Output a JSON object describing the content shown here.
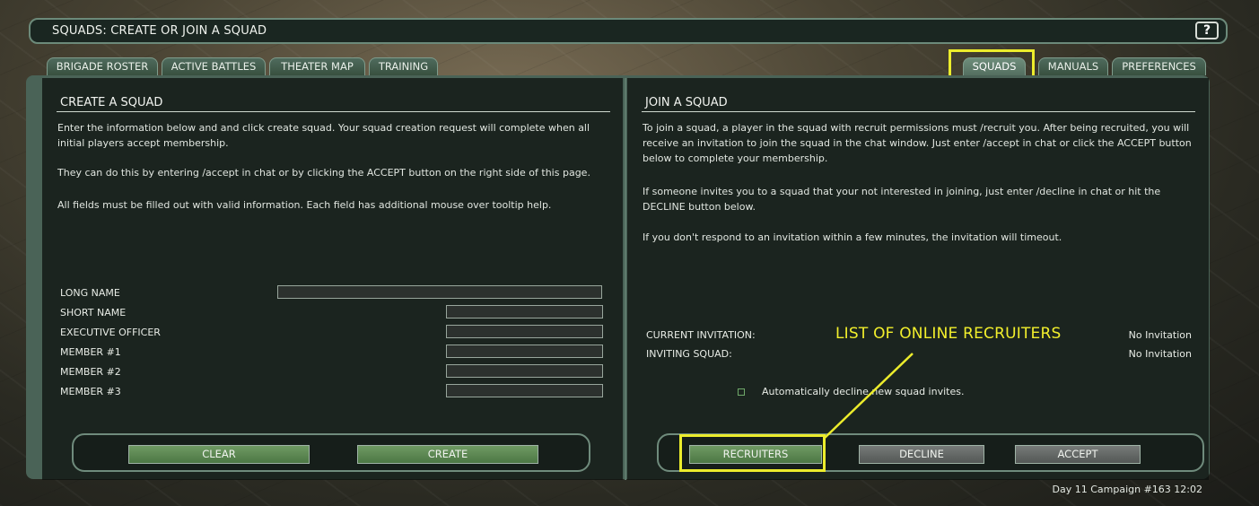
{
  "window": {
    "title": "SQUADS: CREATE OR JOIN A SQUAD",
    "help_label": "?"
  },
  "tabs_left": [
    {
      "label": "BRIGADE ROSTER"
    },
    {
      "label": "ACTIVE BATTLES"
    },
    {
      "label": "THEATER MAP"
    },
    {
      "label": "TRAINING"
    }
  ],
  "tabs_right": [
    {
      "label": "SQUADS",
      "active": true
    },
    {
      "label": "MANUALS"
    },
    {
      "label": "PREFERENCES"
    }
  ],
  "create_squad": {
    "title": "CREATE A SQUAD",
    "paragraphs": [
      "Enter the information below and and click create squad. Your squad creation request will complete when all initial players accept membership.",
      "They can do this by entering /accept in chat or by clicking the ACCEPT button on the right side of this page.",
      "All fields must be filled out with valid information. Each field has additional mouse over tooltip help."
    ],
    "fields": [
      {
        "label": "LONG NAME",
        "value": ""
      },
      {
        "label": "SHORT NAME",
        "value": ""
      },
      {
        "label": "EXECUTIVE OFFICER",
        "value": ""
      },
      {
        "label": "MEMBER #1",
        "value": ""
      },
      {
        "label": "MEMBER #2",
        "value": ""
      },
      {
        "label": "MEMBER #3",
        "value": ""
      }
    ],
    "buttons": {
      "clear": "CLEAR",
      "create": "CREATE"
    }
  },
  "join_squad": {
    "title": "JOIN A SQUAD",
    "paragraphs": [
      "To join a squad, a player in the squad with recruit permissions must /recruit you. After being recruited, you will receive an invitation to join the squad in the chat window. Just enter /accept in chat or click the ACCEPT button below to complete your membership.",
      "If someone invites you to a squad that your not interested in joining, just enter /decline in chat or hit the DECLINE button below.",
      "If you don't respond to an invitation within a few minutes, the invitation will timeout."
    ],
    "current_invitation_label": "CURRENT INVITATION:",
    "current_invitation_value": "No Invitation",
    "inviting_squad_label": "INVITING SQUAD:",
    "inviting_squad_value": "No Invitation",
    "auto_decline_label": "Automatically decline new squad invites.",
    "auto_decline_checked": false,
    "buttons": {
      "recruiters": "RECRUITERS",
      "decline": "DECLINE",
      "accept": "ACCEPT"
    }
  },
  "annotation": {
    "text": "LIST OF ONLINE RECRUITERS",
    "color": "#f2ef2c"
  },
  "status_bar": {
    "text": "Day 11 Campaign #163  12:02"
  },
  "colors": {
    "highlight": "#ecec2c",
    "green_button": "#5c8a52",
    "gray_button": "#646866",
    "panel_frame": "#4a6357"
  }
}
